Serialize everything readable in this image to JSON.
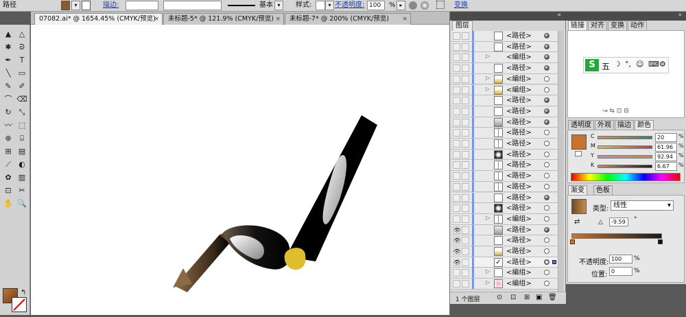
{
  "control_bar": {
    "object_type": "路径",
    "stroke_label": "描边:",
    "stroke_style": "基本",
    "style_label": "样式:",
    "opacity_label": "不透明度:",
    "opacity_value": "100",
    "opacity_unit": "%",
    "transform_label": "变换",
    "fill_color": "#8a5a2e"
  },
  "doc_tabs": [
    {
      "label": "07082.ai* @ 1654.45% (CMYK/预览)",
      "close": "×",
      "active": true
    },
    {
      "label": "未标题-5* @ 121.9% (CMYK/预览)",
      "close": "×",
      "active": false
    },
    {
      "label": "未标题-7* @ 200% (CMYK/预览)",
      "close": "×",
      "active": false
    }
  ],
  "layers_panel": {
    "title": "图层",
    "footer_count": "1 个图层",
    "rows": [
      {
        "name": "<路径>",
        "expand": "",
        "eye": "",
        "target": "filled",
        "thumb": "plain"
      },
      {
        "name": "<路径>",
        "expand": "",
        "eye": "",
        "target": "filled",
        "thumb": "plain"
      },
      {
        "name": "<编组>",
        "expand": "▷",
        "eye": "",
        "target": "filled",
        "thumb": "none"
      },
      {
        "name": "<路径>",
        "expand": "",
        "eye": "",
        "target": "filled",
        "thumb": "plain"
      },
      {
        "name": "<编组>",
        "expand": "▷",
        "eye": "",
        "target": "empty",
        "thumb": "gold"
      },
      {
        "name": "<编组>",
        "expand": "▷",
        "eye": "",
        "target": "empty",
        "thumb": "gold"
      },
      {
        "name": "<路径>",
        "expand": "",
        "eye": "",
        "target": "filled",
        "thumb": "plain"
      },
      {
        "name": "<路径>",
        "expand": "",
        "eye": "",
        "target": "filled",
        "thumb": "plain"
      },
      {
        "name": "<路径>",
        "expand": "",
        "eye": "",
        "target": "filled",
        "thumb": "light"
      },
      {
        "name": "<路径>",
        "expand": "",
        "eye": "",
        "target": "empty",
        "thumb": "line"
      },
      {
        "name": "<路径>",
        "expand": "",
        "eye": "",
        "target": "empty",
        "thumb": "line"
      },
      {
        "name": "<路径>",
        "expand": "",
        "eye": "",
        "target": "empty",
        "thumb": "dark"
      },
      {
        "name": "<路径>",
        "expand": "",
        "eye": "",
        "target": "empty",
        "thumb": "line"
      },
      {
        "name": "<路径>",
        "expand": "",
        "eye": "",
        "target": "empty",
        "thumb": "line"
      },
      {
        "name": "<路径>",
        "expand": "",
        "eye": "",
        "target": "empty",
        "thumb": "line"
      },
      {
        "name": "<路径>",
        "expand": "",
        "eye": "",
        "target": "filled",
        "thumb": "plain"
      },
      {
        "name": "<路径>",
        "expand": "",
        "eye": "",
        "target": "empty",
        "thumb": "dark"
      },
      {
        "name": "<编组>",
        "expand": "▷",
        "eye": "",
        "target": "empty",
        "thumb": "line"
      },
      {
        "name": "<路径>",
        "expand": "",
        "eye": "👁",
        "target": "filled",
        "thumb": "light"
      },
      {
        "name": "<路径>",
        "expand": "",
        "eye": "👁",
        "target": "empty",
        "thumb": "plain"
      },
      {
        "name": "<路径>",
        "expand": "",
        "eye": "👁",
        "target": "empty",
        "thumb": "gold"
      },
      {
        "name": "<路径>",
        "expand": "",
        "eye": "👁",
        "target": "selected",
        "thumb": "check"
      },
      {
        "name": "<编组>",
        "expand": "▷",
        "eye": "",
        "target": "empty",
        "thumb": "plain"
      },
      {
        "name": "<编组>",
        "expand": "▷",
        "eye": "",
        "target": "empty",
        "thumb": "pink"
      }
    ]
  },
  "right_panels": {
    "top_tabs": [
      "链接",
      "对齐",
      "变换",
      "动作"
    ],
    "ime_bar": "五",
    "color_tabs": [
      "透明度",
      "外观",
      "描边",
      "颜色"
    ],
    "color_sliders": [
      {
        "label": "C",
        "value": "20",
        "unit": "%"
      },
      {
        "label": "M",
        "value": "61.96",
        "unit": "%"
      },
      {
        "label": "Y",
        "value": "92.94",
        "unit": "%"
      },
      {
        "label": "K",
        "value": "6.67",
        "unit": "%"
      }
    ],
    "gradient_tabs": [
      "渐变",
      "色板"
    ],
    "gradient_type_label": "类型:",
    "gradient_type_value": "线性",
    "gradient_angle": "-9.59",
    "gradient_angle_unit": "°",
    "opacity_label": "不透明度:",
    "opacity_value": "100",
    "opacity_unit": "%",
    "position_label": "位置:",
    "position_value": "0",
    "position_unit": "%",
    "current_color": "#c87430"
  },
  "tool_icons": [
    "selection-icon",
    "direct-selection-icon",
    "magic-wand-icon",
    "lasso-icon",
    "pen-icon",
    "type-icon",
    "line-icon",
    "rectangle-icon",
    "paintbrush-icon",
    "pencil-icon",
    "blob-brush-icon",
    "eraser-icon",
    "rotate-icon",
    "scale-icon",
    "warp-icon",
    "free-transform-icon",
    "shape-builder-icon",
    "perspective-icon",
    "mesh-icon",
    "gradient-icon",
    "eyedropper-icon",
    "blend-icon",
    "symbol-sprayer-icon",
    "graph-icon",
    "artboard-icon",
    "slice-icon",
    "hand-icon",
    "zoom-icon"
  ]
}
